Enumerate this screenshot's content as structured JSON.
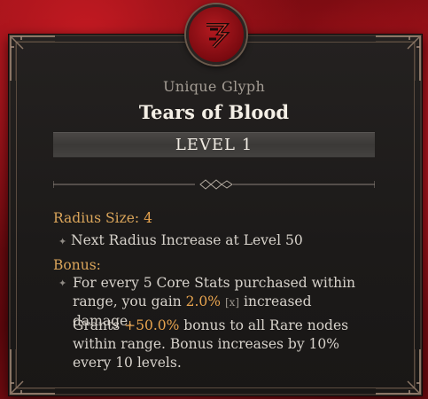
{
  "glyph": {
    "type_label": "Unique Glyph",
    "name": "Tears of Blood",
    "level_label": "LEVEL 1",
    "emblem_icon": "blood-rune-icon"
  },
  "radius": {
    "label": "Radius Size:",
    "value": "4",
    "next_increase": "Next Radius Increase at Level 50"
  },
  "bonus": {
    "label": "Bonus:",
    "line1_a": "For every 5 Core Stats purchased within range, you gain ",
    "line1_value": "2.0%",
    "line1_tag": "[x]",
    "line1_b": " increased damage.",
    "line2_a": "Grants ",
    "line2_value": "+50.0%",
    "line2_b": " bonus to all Rare nodes within range. Bonus increases by 10% every 10 levels."
  },
  "colors": {
    "accent": "#e8a44f",
    "background_red": "#7a0c12",
    "panel": "#1f1c1b"
  }
}
